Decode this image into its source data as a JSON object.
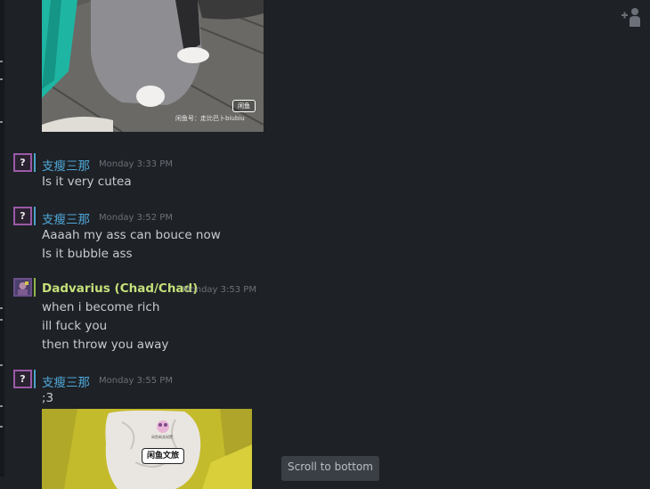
{
  "messages": [
    {
      "sender": "支瘦三那",
      "timestamp": "Monday 3:33 PM",
      "lines": [
        "Is it very cutea"
      ]
    },
    {
      "sender": "支瘦三那",
      "timestamp": "Monday 3:52 PM",
      "lines": [
        "Aaaah my ass can bouce now",
        "Is it bubble ass"
      ]
    },
    {
      "sender": "Dadvarius (Chad/Chad)",
      "timestamp": "Monday 3:53 PM",
      "lines": [
        "when i become rich",
        "ill fuck you",
        "then throw you away"
      ]
    },
    {
      "sender": "支瘦三那",
      "timestamp": "Monday 3:55 PM",
      "lines": [
        ";3"
      ]
    }
  ],
  "top_image": {
    "watermark_badge": "闲鱼",
    "watermark_text": "闲鱼号：走比巴卜biubiu"
  },
  "bottom_image": {
    "sticker_small": "闲鱼新卖闲置",
    "sticker_text": "闲鱼文旅"
  },
  "avatar_placeholder": "?",
  "scroll_button_label": "Scroll to bottom",
  "colors": {
    "background": "#1e2126",
    "name_online": "#4fa8d8",
    "name_ingame": "#c5e07a",
    "message_text": "#c7cbd1",
    "timestamp": "#6b7178"
  },
  "icons": {
    "avatar_unknown": "question-mark-icon",
    "add_friend": "add-friend-icon"
  }
}
